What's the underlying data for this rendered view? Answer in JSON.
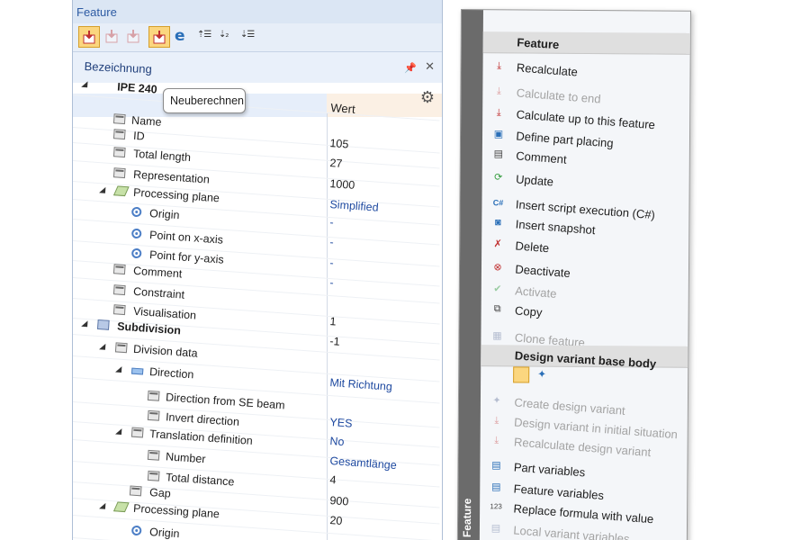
{
  "panel": {
    "title": "Feature",
    "tab_label": "Bezeichnung",
    "tooltip": "Neuberechnen",
    "header_value_label": "Wert",
    "rows": [
      {
        "label": "IPE 240",
        "bold": true
      },
      {
        "label": "Name"
      },
      {
        "label": "ID"
      },
      {
        "label": "Total length"
      },
      {
        "label": "Representation"
      },
      {
        "label": "Processing plane"
      },
      {
        "label": "Origin"
      },
      {
        "label": "Point on x-axis"
      },
      {
        "label": "Point for y-axis"
      },
      {
        "label": "Comment"
      },
      {
        "label": "Constraint"
      },
      {
        "label": "Visualisation"
      },
      {
        "label": "Subdivision",
        "bold": true
      },
      {
        "label": "Division data"
      },
      {
        "label": "Direction"
      },
      {
        "label": "Direction from SE beam"
      },
      {
        "label": "Invert direction"
      },
      {
        "label": "Translation definition"
      },
      {
        "label": "Number"
      },
      {
        "label": "Total distance"
      },
      {
        "label": "Gap"
      },
      {
        "label": "Processing plane"
      },
      {
        "label": "Origin"
      }
    ],
    "values": [
      "105",
      "27",
      "1000",
      "Simplified",
      "-",
      "-",
      "-",
      "-",
      "1",
      "-1",
      "Mit Richtung",
      "YES",
      "No",
      "Gesamtlänge",
      "4",
      "900",
      "20"
    ]
  },
  "menu": {
    "strip_label": "Feature",
    "section1_title": "Feature",
    "section1_items": [
      {
        "label": "Recalculate",
        "enabled": true,
        "icon": "recalculate-icon"
      },
      {
        "label": "Calculate to end",
        "enabled": false,
        "icon": "calculate-to-end-icon"
      },
      {
        "label": "Calculate up to this feature",
        "enabled": true,
        "icon": "calculate-up-to-icon"
      },
      {
        "label": "Define part placing",
        "enabled": true,
        "icon": "part-placing-icon"
      },
      {
        "label": "Comment",
        "enabled": true,
        "icon": "comment-icon"
      },
      {
        "label": "Update",
        "enabled": true,
        "icon": "update-icon"
      },
      {
        "label": "Insert script execution (C#)",
        "enabled": true,
        "icon": "csharp-script-icon"
      },
      {
        "label": "Insert snapshot",
        "enabled": true,
        "icon": "camera-icon"
      },
      {
        "label": "Delete",
        "enabled": true,
        "icon": "delete-icon"
      },
      {
        "label": "Deactivate",
        "enabled": true,
        "icon": "deactivate-icon"
      },
      {
        "label": "Activate",
        "enabled": false,
        "icon": "activate-icon"
      },
      {
        "label": "Copy",
        "enabled": true,
        "icon": "copy-icon"
      },
      {
        "label": "Clone feature",
        "enabled": false,
        "icon": "clone-icon"
      }
    ],
    "section2_title": "Design variant base body",
    "section2_items": [
      {
        "label": "Create design variant",
        "enabled": false,
        "icon": "create-variant-icon"
      },
      {
        "label": "Design variant in initial situation",
        "enabled": false,
        "icon": "variant-initial-icon"
      },
      {
        "label": "Recalculate design variant",
        "enabled": false,
        "icon": "recalculate-variant-icon"
      },
      {
        "label": "Part variables",
        "enabled": true,
        "icon": "part-variables-icon"
      },
      {
        "label": "Feature variables",
        "enabled": true,
        "icon": "feature-variables-icon"
      },
      {
        "label": "Replace formula with value",
        "enabled": true,
        "icon": "replace-formula-icon"
      },
      {
        "label": "Local variant variables",
        "enabled": false,
        "icon": "local-variables-icon"
      }
    ]
  }
}
